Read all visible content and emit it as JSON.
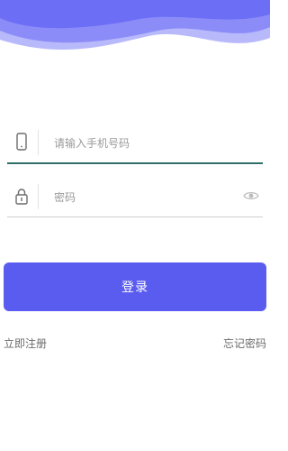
{
  "form": {
    "phone": {
      "placeholder": "请输入手机号码",
      "value": ""
    },
    "password": {
      "placeholder": "密码",
      "value": ""
    }
  },
  "actions": {
    "login_label": "登录",
    "register_label": "立即注册",
    "forgot_label": "忘记密码"
  },
  "theme": {
    "accent": "#5a5cf0",
    "header_wave_colors": [
      "#6c6ef6",
      "#8b8cf7",
      "#b8b9fb"
    ],
    "active_underline": "#2f6f6a"
  },
  "icons": {
    "phone": "phone-icon",
    "lock": "lock-icon",
    "eye": "eye-icon"
  }
}
